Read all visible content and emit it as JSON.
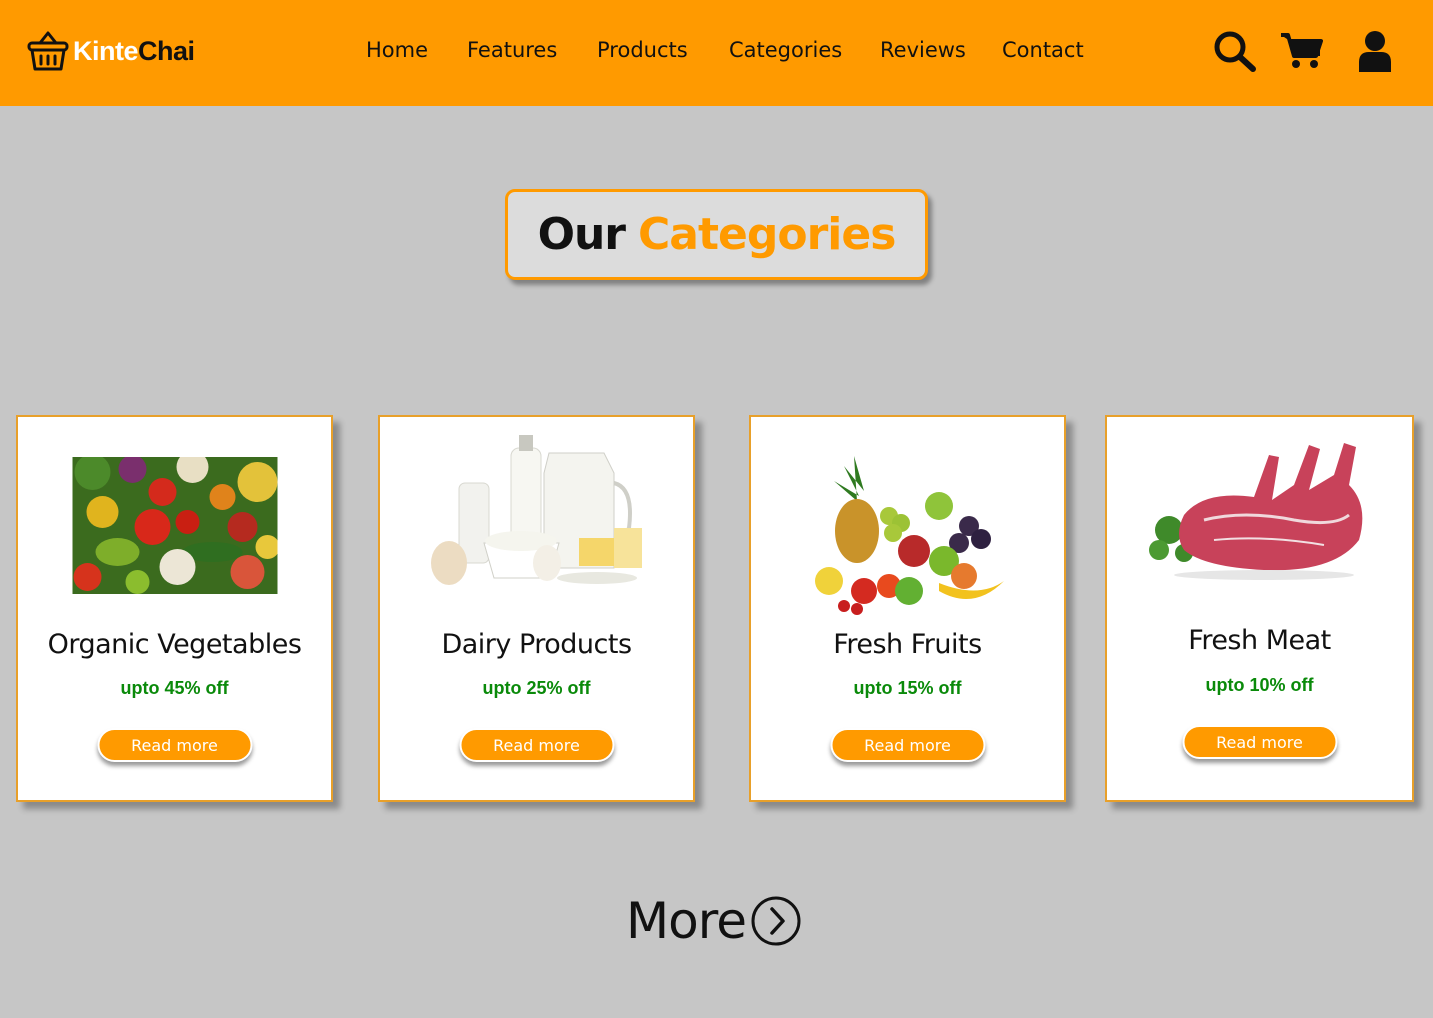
{
  "brand": {
    "name_part1": "Kinte",
    "name_part2": "Chai"
  },
  "nav": {
    "home": "Home",
    "features": "Features",
    "products": "Products",
    "categories": "Categories",
    "reviews": "Reviews",
    "contact": "Contact"
  },
  "header_icons": [
    "search-icon",
    "cart-icon",
    "user-icon"
  ],
  "section": {
    "title_part1": "Our",
    "title_part2": "Categories"
  },
  "cards": [
    {
      "title": "Organic Vegetables",
      "discount": "upto 45% off",
      "button": "Read more",
      "image": "vegetables"
    },
    {
      "title": "Dairy Products",
      "discount": "upto 25% off",
      "button": "Read more",
      "image": "dairy"
    },
    {
      "title": "Fresh Fruits",
      "discount": "upto 15% off",
      "button": "Read more",
      "image": "fruits"
    },
    {
      "title": "Fresh Meat",
      "discount": "upto 10% off",
      "button": "Read more",
      "image": "meat"
    }
  ],
  "more": {
    "label": "More"
  },
  "colors": {
    "accent": "#ff9a00",
    "background": "#c6c6c6",
    "discount": "#0a8a0a",
    "text": "#111111"
  }
}
